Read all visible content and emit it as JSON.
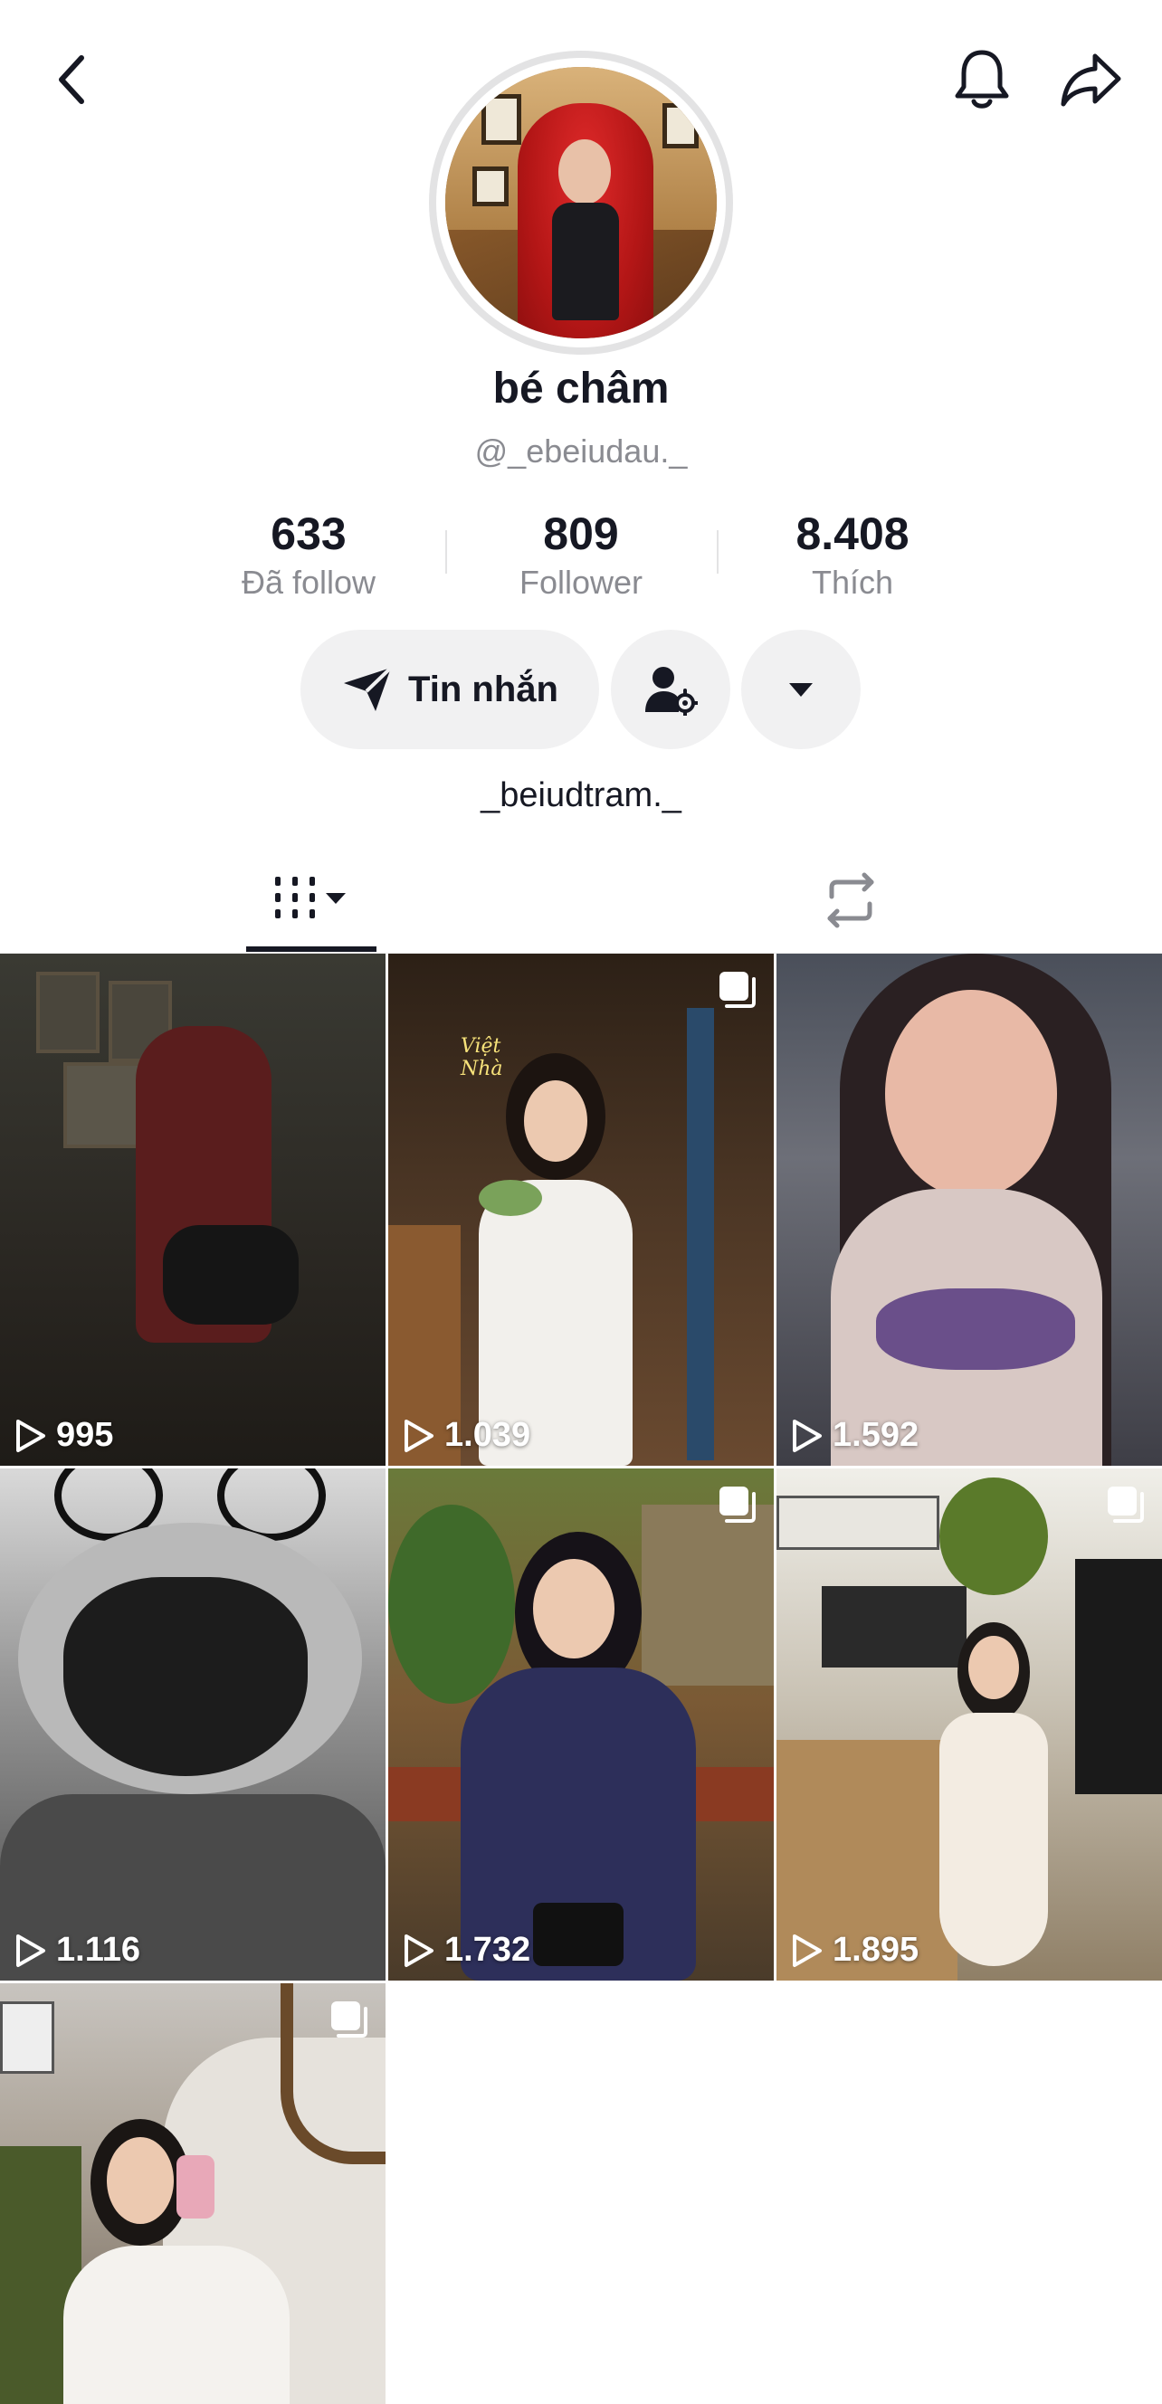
{
  "header": {
    "back_icon": "chevron-left-icon",
    "bell_icon": "bell-icon",
    "share_icon": "share-arrow-icon"
  },
  "profile": {
    "name": "bé châm",
    "handle": "@_ebeiudau._",
    "bio": "_beiudtram._"
  },
  "stats": [
    {
      "value": "633",
      "label": "Đã follow"
    },
    {
      "value": "809",
      "label": "Follower"
    },
    {
      "value": "8.408",
      "label": "Thích"
    }
  ],
  "actions": {
    "message_label": "Tin nhắn",
    "message_icon": "send-icon",
    "friend_settings_icon": "user-settings-icon",
    "more_icon": "caret-down-icon"
  },
  "tabs": [
    {
      "name": "videos",
      "icon": "grid-icon",
      "active": true
    },
    {
      "name": "reposts",
      "icon": "repost-icon",
      "active": false
    }
  ],
  "videos": [
    {
      "views": "995",
      "multi": false
    },
    {
      "views": "1.039",
      "multi": true
    },
    {
      "views": "1.592",
      "multi": false
    },
    {
      "views": "1.116",
      "multi": false
    },
    {
      "views": "1.732",
      "multi": true
    },
    {
      "views": "1.895",
      "multi": true
    },
    {
      "views": "",
      "multi": true
    }
  ],
  "colors": {
    "text": "#161823",
    "muted": "#8a8b91",
    "button_bg": "#f1f1f2",
    "ring": "#e3e3e4"
  }
}
